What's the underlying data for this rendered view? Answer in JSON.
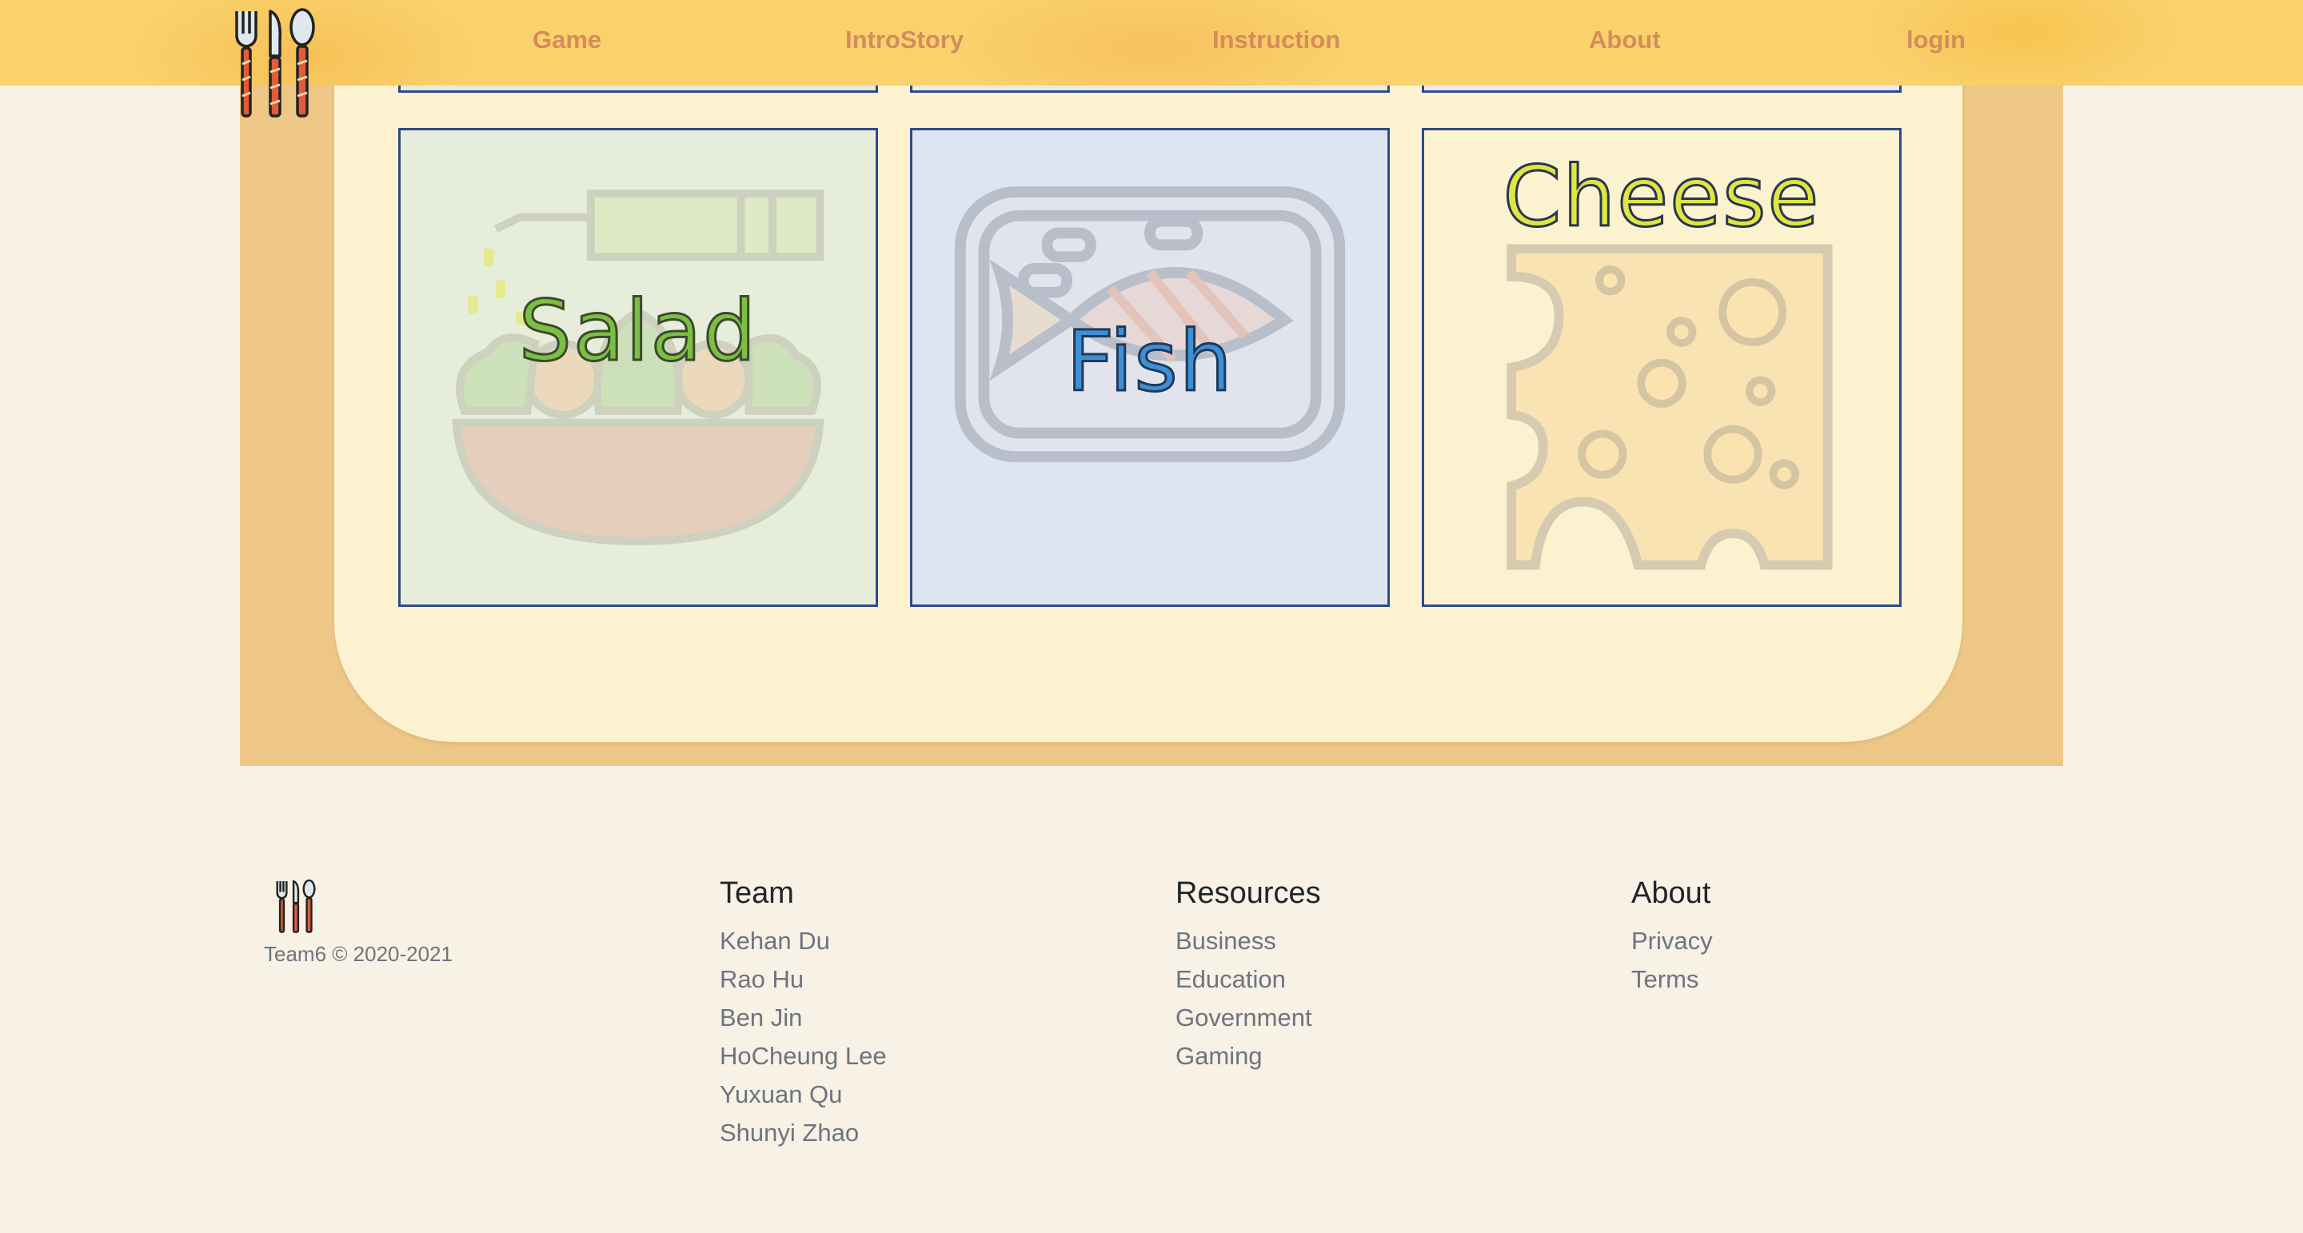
{
  "nav": {
    "items": [
      "Game",
      "IntroStory",
      "Instruction",
      "About",
      "login"
    ]
  },
  "cards": [
    {
      "title": "Salad",
      "icon": "salad-bowl-icon",
      "bg": "#e6eedb",
      "title_color": "#7cbf45"
    },
    {
      "title": "Fish",
      "icon": "fish-tray-icon",
      "bg": "#dde4f2",
      "title_color": "#3f8fd4"
    },
    {
      "title": "Cheese",
      "icon": "cheese-icon",
      "bg": "#fdf2d0",
      "title_color": "#dfe641"
    }
  ],
  "footer": {
    "copyright": "Team6 © 2020-2021",
    "columns": [
      {
        "heading": "Team",
        "links": [
          "Kehan Du",
          "Rao Hu",
          "Ben Jin",
          "HoCheung Lee",
          "Yuxuan Qu",
          "Shunyi Zhao"
        ]
      },
      {
        "heading": "Resources",
        "links": [
          "Business",
          "Education",
          "Government",
          "Gaming"
        ]
      },
      {
        "heading": "About",
        "links": [
          "Privacy",
          "Terms"
        ]
      }
    ]
  },
  "colors": {
    "nav_bg": "#f9d26e",
    "nav_link": "#d58b5a",
    "panel_outer": "#eec787",
    "panel_inner": "#fdf2d0",
    "card_border": "#2c4a86",
    "page_bg": "#f8f1e6"
  }
}
